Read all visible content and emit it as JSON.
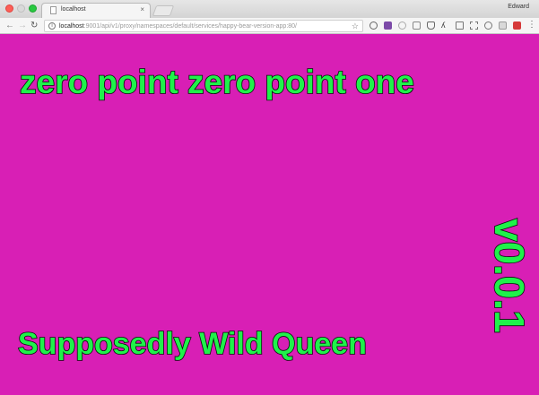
{
  "browser": {
    "tab_title": "localhost",
    "tab_close": "×",
    "profile_name": "Edward",
    "url_host": "localhost",
    "url_rest": ":9001/api/v1/proxy/namespaces/default/services/happy-bear-version-app:80/",
    "icons": {
      "back": "arrow-left-icon",
      "forward": "arrow-right-icon",
      "reload": "reload-icon",
      "info": "info-icon",
      "bookmark": "star-icon",
      "menu": "menu-icon"
    }
  },
  "page": {
    "background_color": "#d81fb5",
    "text_color": "#1ff24a",
    "headline": "zero point zero point one",
    "name": "Supposedly Wild Queen",
    "version": "v0.0.1"
  }
}
